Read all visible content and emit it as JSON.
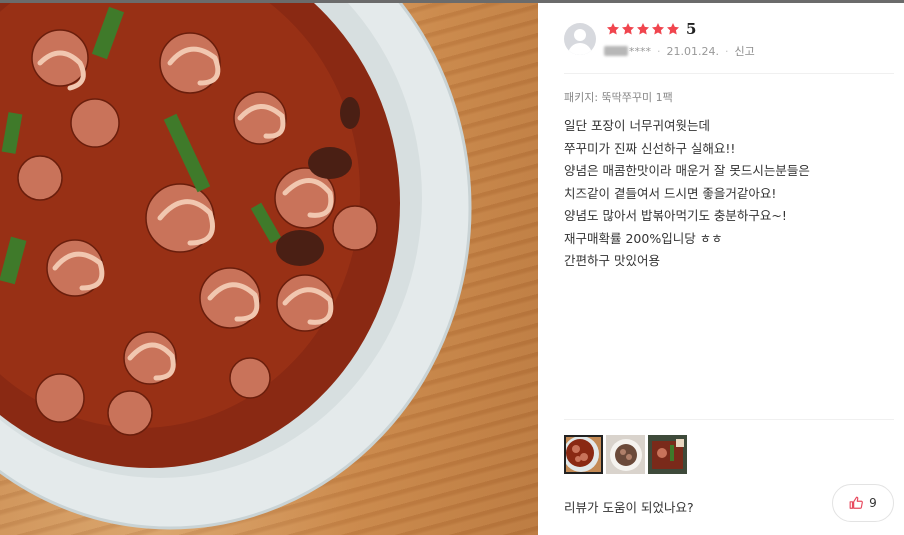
{
  "photo": {
    "alt_name": "spicy-stir-fried-webfoot-octopus-photo"
  },
  "review": {
    "rating_stars": 5,
    "score": "5",
    "username_suffix": "****",
    "date": "21.01.24.",
    "report_label": "신고",
    "package": "패키지: 뚝딱쭈꾸미 1팩",
    "lines": [
      "일단 포장이 너무귀여웟는데",
      "쭈꾸미가 진짜 신선하구 실해요!!",
      "양념은 매콤한맛이라 매운거 잘 못드시는분들은",
      "치즈같이 곁들여서 드시면 좋을거같아요!",
      "양념도 많아서 밥볶아먹기도 충분하구요~!",
      "재구매확률 200%입니당 ㅎㅎ",
      "간편하구 맛있어용"
    ],
    "helpful_question": "리뷰가 도움이 되었나요?",
    "like_count": "9"
  },
  "colors": {
    "star": "#f0454e",
    "thumb_icon": "#e84a5f",
    "sauce": "#8e2a12",
    "plate": "#e6ebec"
  },
  "icons": [
    "user-avatar-icon",
    "star-icon",
    "thumbs-up-icon"
  ]
}
